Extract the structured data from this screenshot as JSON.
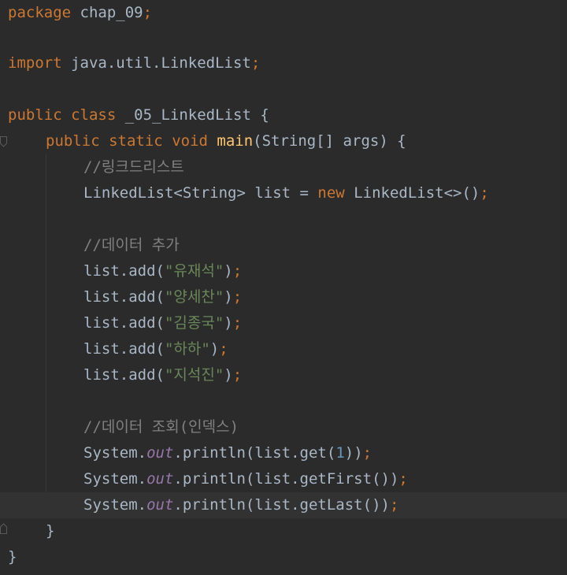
{
  "code": {
    "package_kw": "package",
    "package_name": " chap_09",
    "import_kw": "import",
    "import_path": " java.util.LinkedList",
    "class_public": "public",
    "class_kw": "class",
    "class_name": " _05_LinkedList {",
    "main_public": "public",
    "main_static": "static",
    "main_void": "void",
    "main_name": "main",
    "main_params": "(String[] args) {",
    "comment_linkedlist": "//링크드리스트",
    "decl_left": "LinkedList<String> list = ",
    "decl_new": "new",
    "decl_right": " LinkedList<>()",
    "comment_add": "//데이터 추가",
    "add_prefix": "list.add(",
    "add_1": "\"유재석\"",
    "add_2": "\"양세찬\"",
    "add_3": "\"김종국\"",
    "add_4": "\"하하\"",
    "add_5": "\"지석진\"",
    "close_paren": ")",
    "semicolon": ";",
    "comment_index": "//데이터 조회(인덱스)",
    "system": "System.",
    "out": "out",
    "println_open": ".println(list.get(",
    "index_num": "1",
    "close_two": "))",
    "println_first": ".println(list.getFirst())",
    "println_last": ".println(list.getLast())",
    "brace_close": "}"
  },
  "colors": {
    "background": "#2b2b2b",
    "keyword": "#cc7832",
    "function": "#ffc66d",
    "string": "#6a8759",
    "comment": "#808080",
    "number": "#6897bb",
    "field": "#9876aa",
    "text": "#a9b7c6"
  }
}
